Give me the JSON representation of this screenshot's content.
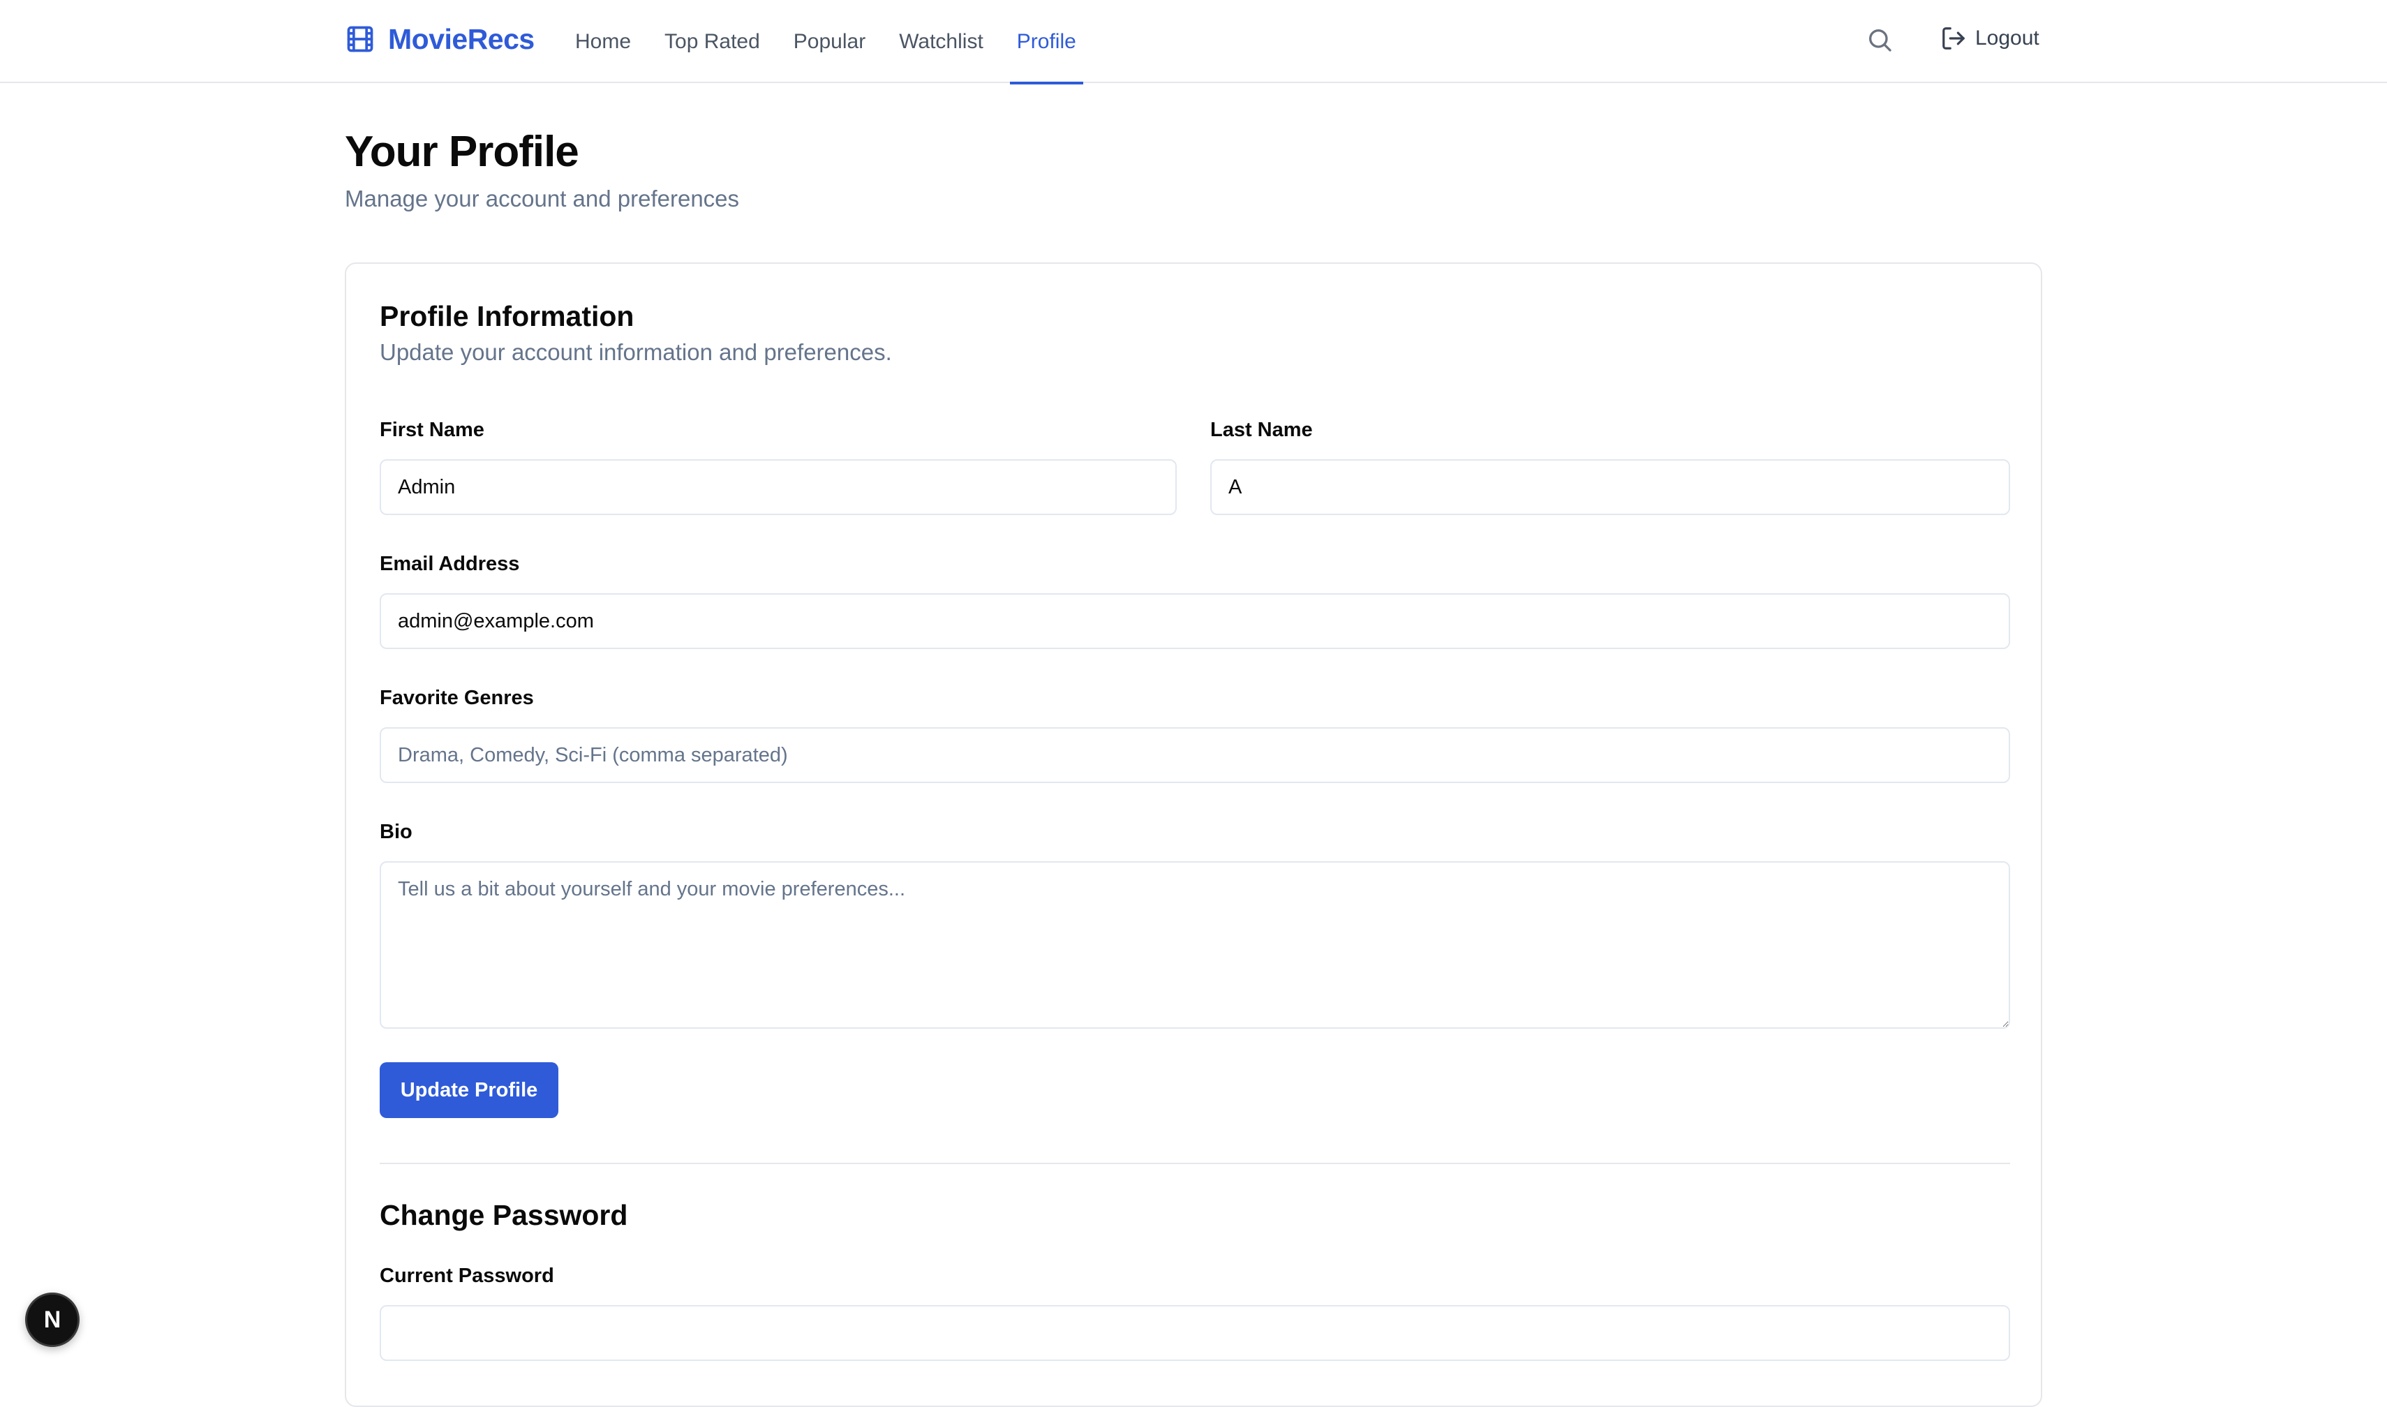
{
  "app": {
    "name": "MovieRecs",
    "brand_icon": "film-icon",
    "accent_color": "#2f5bd8"
  },
  "nav": {
    "items": [
      {
        "label": "Home"
      },
      {
        "label": "Top Rated"
      },
      {
        "label": "Popular"
      },
      {
        "label": "Watchlist"
      },
      {
        "label": "Profile",
        "active": true
      }
    ],
    "search_icon": "search-icon",
    "logout_label": "Logout",
    "logout_icon": "logout-icon"
  },
  "page": {
    "title": "Your Profile",
    "subtitle": "Manage your account and preferences"
  },
  "profile_card": {
    "title": "Profile Information",
    "subtitle": "Update your account information and preferences.",
    "first_name": {
      "label": "First Name",
      "value": "Admin"
    },
    "last_name": {
      "label": "Last Name",
      "value": "A"
    },
    "email": {
      "label": "Email Address",
      "value": "admin@example.com"
    },
    "genres": {
      "label": "Favorite Genres",
      "value": "",
      "placeholder": "Drama, Comedy, Sci-Fi (comma separated)"
    },
    "bio": {
      "label": "Bio",
      "value": "",
      "placeholder": "Tell us a bit about yourself and your movie preferences..."
    },
    "submit_label": "Update Profile"
  },
  "password_section": {
    "title": "Change Password",
    "current_password": {
      "label": "Current Password",
      "value": ""
    }
  },
  "badge": {
    "letter": "N"
  }
}
